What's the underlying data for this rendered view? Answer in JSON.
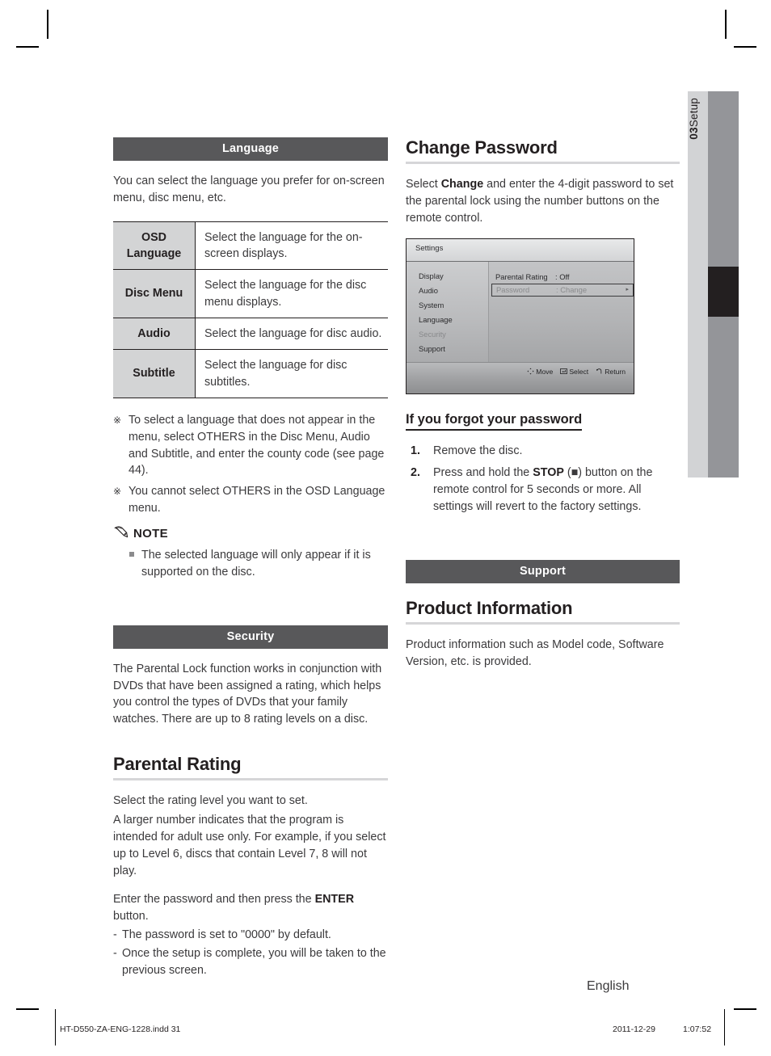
{
  "side_tab": {
    "chapter_number": "03",
    "chapter_label": "Setup"
  },
  "left_column": {
    "language_section": {
      "band_title": "Language",
      "intro": "You can select the language you prefer for on-screen menu, disc menu, etc.",
      "table": {
        "rows": [
          {
            "label": "OSD Language",
            "label_line1": "OSD",
            "label_line2": "Language",
            "description": "Select the language for the on-screen displays."
          },
          {
            "label": "Disc Menu",
            "label_line1": "Disc Menu",
            "label_line2": "",
            "description": "Select the language for the disc menu displays."
          },
          {
            "label": "Audio",
            "label_line1": "Audio",
            "label_line2": "",
            "description": "Select the language for disc audio."
          },
          {
            "label": "Subtitle",
            "label_line1": "Subtitle",
            "label_line2": "",
            "description": "Select the language for disc subtitles."
          }
        ]
      },
      "asterisk_notes": [
        {
          "mark": "※",
          "text": "To select a language that does not appear in the menu, select OTHERS in the Disc Menu, Audio and Subtitle, and enter the county code (see page 44)."
        },
        {
          "mark": "※",
          "text": "You cannot select OTHERS in the OSD Language menu."
        }
      ],
      "note": {
        "icon": "pencil-icon",
        "label": "NOTE",
        "bullets": [
          "The selected language will only appear if it is supported on the disc."
        ]
      }
    },
    "security_section": {
      "band_title": "Security",
      "intro": "The Parental Lock function works in conjunction with DVDs that have been assigned a rating, which helps you control the types of DVDs that your family watches. There are up to 8 rating levels on a disc.",
      "parental_rating": {
        "heading": "Parental Rating",
        "para1": "Select the rating level you want to set.",
        "para2": "A larger number indicates that the program is intended for adult use only. For example, if you select up to Level 6, discs that contain Level 7, 8 will not play.",
        "para3_pre": "Enter the password and then press the ",
        "para3_bold": "ENTER",
        "para3_post": " button.",
        "dash_items": [
          "The password is set to \"0000\" by default.",
          "Once the setup is complete, you will be taken to the previous screen."
        ]
      }
    }
  },
  "right_column": {
    "change_password": {
      "heading": "Change Password",
      "para_pre": "Select ",
      "para_bold": "Change",
      "para_post": " and enter the 4-digit password to set the parental lock using the number buttons on the remote control."
    },
    "osd_screenshot": {
      "title": "Settings",
      "menu_items": [
        {
          "label": "Display",
          "selected": false
        },
        {
          "label": "Audio",
          "selected": false
        },
        {
          "label": "System",
          "selected": false
        },
        {
          "label": "Language",
          "selected": false
        },
        {
          "label": "Security",
          "selected": true
        },
        {
          "label": "Support",
          "selected": false
        }
      ],
      "rows": [
        {
          "key": "Parental Rating",
          "value": ": Off",
          "highlighted": false
        },
        {
          "key": "Password",
          "value": ": Change",
          "highlighted": true,
          "arrow": "▸"
        }
      ],
      "footer_items": [
        {
          "icon": "move-dpad-icon",
          "label": "Move"
        },
        {
          "icon": "enter-select-icon",
          "label": "Select"
        },
        {
          "icon": "return-arrow-icon",
          "label": "Return"
        }
      ]
    },
    "forgot_password": {
      "heading": "If you forgot your password",
      "steps": [
        {
          "number": "1.",
          "text": "Remove the disc."
        },
        {
          "number": "2.",
          "pre": "Press and hold the ",
          "bold": "STOP",
          "mid": " (■) button on the remote control for 5 seconds or more. All settings will revert to the factory settings."
        }
      ]
    },
    "support_section": {
      "band_title": "Support",
      "product_information": {
        "heading": "Product Information",
        "para": "Product information such as Model code, Software Version, etc. is provided."
      }
    }
  },
  "page_footer": {
    "language_label": "English",
    "file_name": "HT-D550-ZA-ENG-1228.indd   31",
    "date": "2011-12-29",
    "time": "1:07:52"
  },
  "colors": {
    "band_background": "#58585a",
    "table_label_background": "#d3d4d5",
    "side_tab_background": "#d2d3d5",
    "side_bar_background": "#949599",
    "side_bar_marker": "#231f20",
    "rule_gray": "#d6d6d8",
    "text": "#3b3a3c"
  }
}
